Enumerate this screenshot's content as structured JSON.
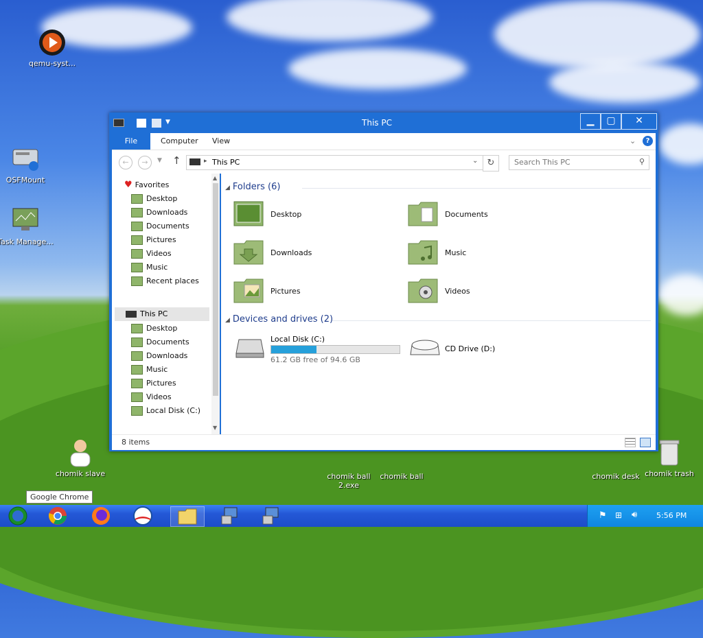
{
  "desktop": {
    "icons": [
      {
        "label": "qemu-syst..."
      },
      {
        "label": "OSFMount"
      },
      {
        "label": "Task Manage..."
      },
      {
        "label": "chomik slave"
      },
      {
        "label": "chomik ball 2.exe"
      },
      {
        "label": "chomik ball"
      },
      {
        "label": "chomik desk"
      },
      {
        "label": "chomik trash"
      }
    ]
  },
  "window": {
    "title": "This PC",
    "controls": {
      "minimize": "▁",
      "maximize": "▢",
      "close": "✕"
    },
    "ribbon": {
      "tabs": [
        "File",
        "Computer",
        "View"
      ]
    },
    "address": {
      "path": "This PC"
    },
    "search": {
      "placeholder": "Search This PC"
    },
    "nav": {
      "favorites_header": "Favorites",
      "favorites": [
        "Desktop",
        "Downloads",
        "Documents",
        "Pictures",
        "Videos",
        "Music",
        "Recent places"
      ],
      "thispc_header": "This PC",
      "thispc_items": [
        "Desktop",
        "Documents",
        "Downloads",
        "Music",
        "Pictures",
        "Videos",
        "Local Disk (C:)"
      ]
    },
    "content": {
      "folders_header": "Folders (6)",
      "folders": [
        "Desktop",
        "Documents",
        "Downloads",
        "Music",
        "Pictures",
        "Videos"
      ],
      "drives_header": "Devices and drives (2)",
      "drives": [
        {
          "name": "Local Disk (C:)",
          "free": "61.2 GB free of 94.6 GB",
          "used_fraction": 0.353
        },
        {
          "name": "CD Drive (D:)"
        }
      ]
    },
    "status": {
      "items": "8 items"
    }
  },
  "taskbar": {
    "tooltip": "Google Chrome",
    "clock": "5:56 PM"
  },
  "colors": {
    "window_accent": "#1f6fd6",
    "taskbar": "#2458d6",
    "tray": "#1290e6",
    "drive_bar": "#26a0da"
  }
}
